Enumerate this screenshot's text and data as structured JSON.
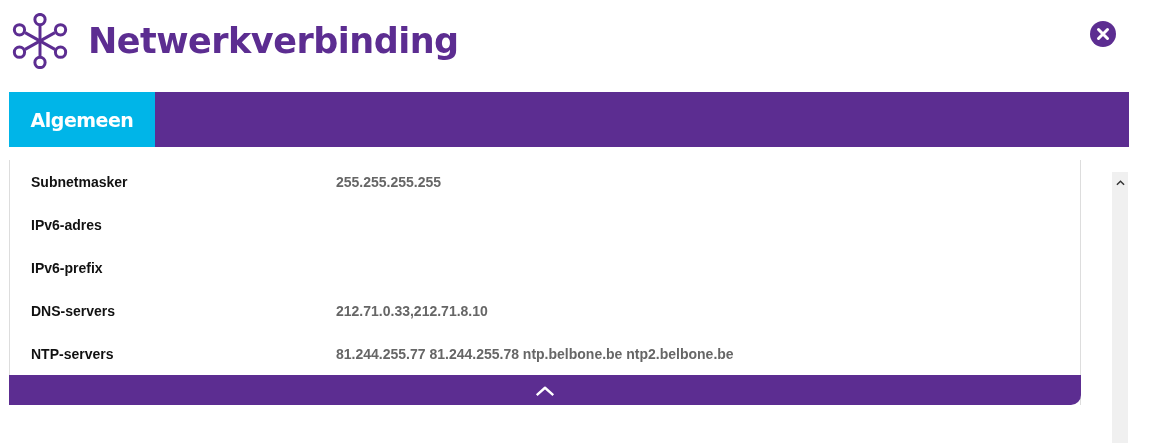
{
  "window": {
    "title": "Netwerkverbinding"
  },
  "tabs": [
    {
      "label": "Algemeen",
      "selected": true
    }
  ],
  "rows": [
    {
      "label": "Subnetmasker",
      "value": "255.255.255.255"
    },
    {
      "label": "IPv6-adres"
    },
    {
      "label": "IPv6-prefix"
    },
    {
      "label": "DNS-servers",
      "value": "212.71.0.33,212.71.8.10"
    },
    {
      "label": "NTP-servers",
      "value": "81.244.255.77 81.244.255.78 ntp.belbone.be ntp2.belbone.be"
    }
  ]
}
